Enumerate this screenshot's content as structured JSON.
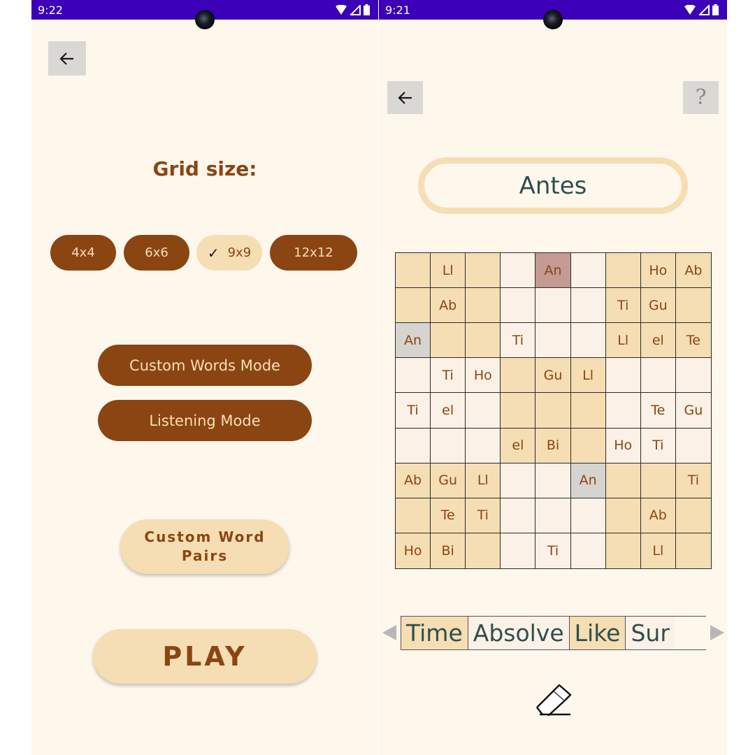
{
  "left_screen": {
    "status_time": "9:22",
    "grid_size_title": "Grid size:",
    "chips": [
      {
        "label": "4x4",
        "selected": false
      },
      {
        "label": "6x6",
        "selected": false
      },
      {
        "label": "9x9",
        "selected": true
      },
      {
        "label": "12x12",
        "selected": false
      }
    ],
    "custom_words_mode": "Custom Words Mode",
    "listening_mode": "Listening Mode",
    "custom_word_pairs_line1": "Custom Word",
    "custom_word_pairs_line2": "Pairs",
    "play": "PLAY"
  },
  "right_screen": {
    "status_time": "9:21",
    "help_icon_label": "?",
    "current_word": "Antes",
    "grid": {
      "rows": [
        [
          "",
          "Ll",
          "",
          "",
          "An",
          "",
          "",
          "Ho",
          "Ab"
        ],
        [
          "",
          "Ab",
          "",
          "",
          "",
          "",
          "Ti",
          "Gu",
          ""
        ],
        [
          "An",
          "",
          "",
          "Ti",
          "",
          "",
          "Ll",
          "el",
          "Te"
        ],
        [
          "",
          "Ti",
          "Ho",
          "",
          "Gu",
          "Ll",
          "",
          "",
          ""
        ],
        [
          "Ti",
          "el",
          "",
          "",
          "",
          "",
          "",
          "Te",
          "Gu"
        ],
        [
          "",
          "",
          "",
          "el",
          "Bi",
          "",
          "Ho",
          "Ti",
          ""
        ],
        [
          "Ab",
          "Gu",
          "Ll",
          "",
          "",
          "An",
          "",
          "",
          "Ti"
        ],
        [
          "",
          "Te",
          "Ti",
          "",
          "",
          "",
          "",
          "Ab",
          ""
        ],
        [
          "Ho",
          "Bi",
          "",
          "",
          "Ti",
          "",
          "",
          "Ll",
          ""
        ]
      ],
      "highlight": {
        "row": 0,
        "col": 4,
        "color": "#c49a92"
      },
      "selected_cells": [
        {
          "row": 2,
          "col": 0
        },
        {
          "row": 6,
          "col": 5
        }
      ],
      "selected_color": "#d6d4d0"
    },
    "word_tiles": [
      {
        "label": "Time",
        "active": true
      },
      {
        "label": "Absolve",
        "active": false
      },
      {
        "label": "Like",
        "active": true
      },
      {
        "label": "Sur",
        "active": false
      }
    ]
  },
  "colors": {
    "background": "#fdf7ec",
    "status_bar": "#3b00b8",
    "brown": "#8b4513",
    "wheat": "#f5deb3",
    "light_cell": "#fbf1e6",
    "word_text": "#2f4f4f"
  },
  "icons": {
    "back": "arrow-left-icon",
    "help": "question-icon",
    "erase": "eraser-icon",
    "scroll_left": "triangle-left-icon",
    "scroll_right": "triangle-right-icon",
    "wifi": "wifi-icon",
    "signal": "signal-icon",
    "battery": "battery-icon",
    "check": "check-icon"
  }
}
